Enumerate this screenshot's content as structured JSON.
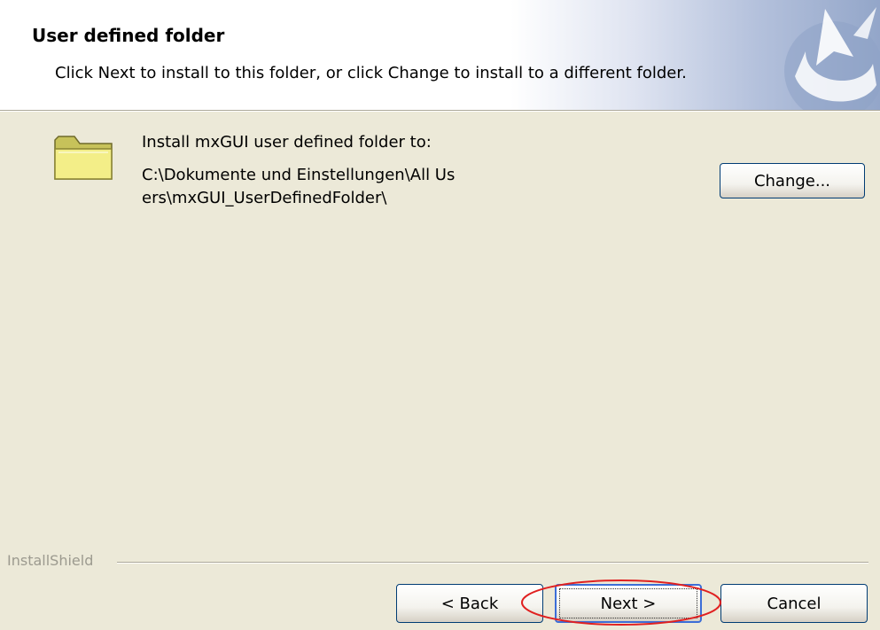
{
  "header": {
    "title": "User defined folder",
    "description": "Click Next to install to this folder, or click Change to install to a different folder.",
    "logo_icon": "installshield-logo-icon"
  },
  "content": {
    "folder_icon": "folder-icon",
    "install_label": "Install mxGUI user defined folder to:",
    "install_path": "C:\\Dokumente und Einstellungen\\All Users\\mxGUI_UserDefinedFolder\\",
    "change_label": "Change..."
  },
  "footer": {
    "brand": "InstallShield",
    "back_label": "< Back",
    "next_label": "Next >",
    "cancel_label": "Cancel"
  },
  "colors": {
    "dialog_bg": "#ece9d8",
    "button_border": "#003c74",
    "default_button_focus": "#3c6ed7",
    "highlight": "#e02020"
  }
}
